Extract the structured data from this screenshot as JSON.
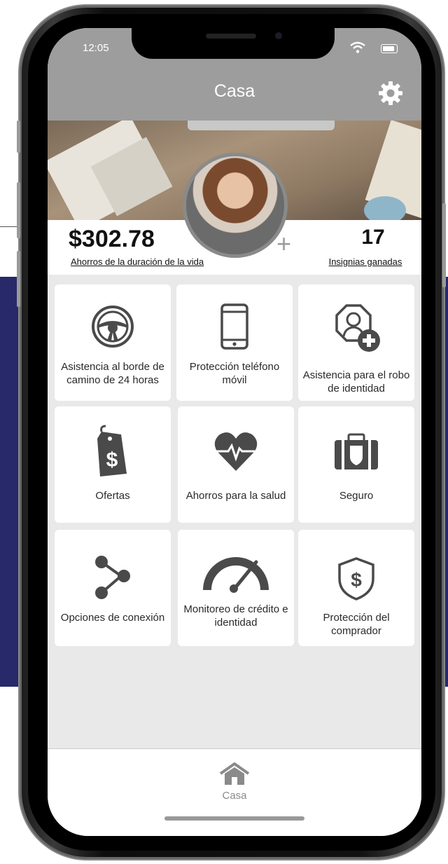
{
  "status_bar": {
    "time": "12:05"
  },
  "header": {
    "title": "Casa"
  },
  "stats": {
    "savings_value": "$302.78",
    "savings_label": "Ahorros de la duración de la vida",
    "badges_value": "17",
    "badges_label": "Insignias ganadas"
  },
  "tiles": [
    {
      "label": "Asistencia al borde de camino de 24 horas",
      "icon": "steering-wheel-icon"
    },
    {
      "label": "Protección teléfono móvil",
      "icon": "mobile-phone-icon"
    },
    {
      "label": "Asistencia para el robo de identidad",
      "icon": "identity-theft-icon"
    },
    {
      "label": "Ofertas",
      "icon": "price-tag-icon"
    },
    {
      "label": "Ahorros para la salud",
      "icon": "heart-pulse-icon"
    },
    {
      "label": "Seguro",
      "icon": "insurance-briefcase-icon"
    },
    {
      "label": "Opciones de conexión",
      "icon": "share-icon"
    },
    {
      "label": "Monitoreo de crédito e identidad",
      "icon": "gauge-icon"
    },
    {
      "label": "Protección del comprador",
      "icon": "shield-dollar-icon"
    }
  ],
  "tabbar": {
    "home_label": "Casa"
  },
  "colors": {
    "header": "#9d9d9d",
    "icon": "#4a4a4a",
    "background_band": "#27296a"
  }
}
